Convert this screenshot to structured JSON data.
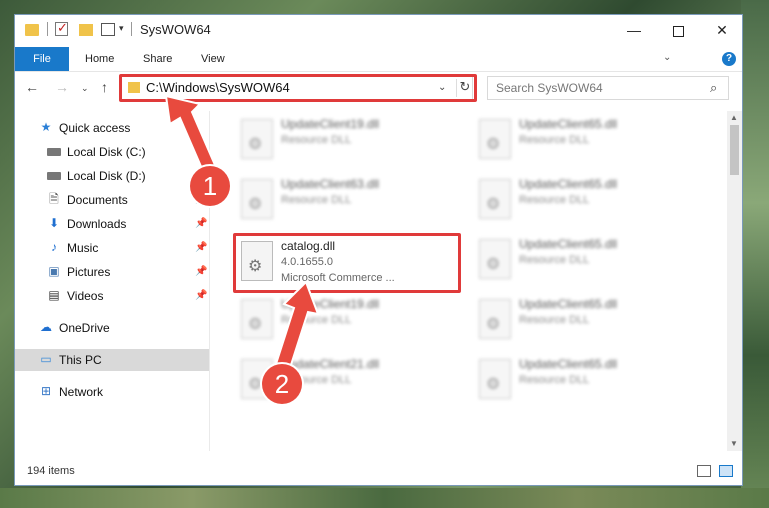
{
  "window": {
    "title": "SysWOW64",
    "controls": {
      "minimize": "—",
      "maximize": "",
      "close": "✕"
    }
  },
  "ribbon": {
    "tabs": [
      "File",
      "Home",
      "Share",
      "View"
    ],
    "collapse_glyph": "⌄",
    "help_glyph": "?"
  },
  "navigation": {
    "back": "←",
    "forward": "→",
    "recent": "⌄",
    "up": "↑",
    "address": "C:\\Windows\\SysWOW64",
    "address_dropdown": "⌄",
    "refresh": "↻",
    "search_placeholder": "Search SysWOW64",
    "search_glyph": "⌕"
  },
  "sidebar": {
    "items": [
      {
        "label": "Quick access",
        "icon": "star-icon",
        "glyph": "★"
      },
      {
        "label": "Local Disk (C:)",
        "icon": "disk-icon",
        "glyph": "",
        "pinned": true
      },
      {
        "label": "Local Disk (D:)",
        "icon": "disk-icon",
        "glyph": "",
        "pinned": true
      },
      {
        "label": "Documents",
        "icon": "documents-icon",
        "glyph": "🗎",
        "pinned": true
      },
      {
        "label": "Downloads",
        "icon": "download-icon",
        "glyph": "⬇",
        "pinned": true
      },
      {
        "label": "Music",
        "icon": "music-icon",
        "glyph": "♪",
        "pinned": true
      },
      {
        "label": "Pictures",
        "icon": "pictures-icon",
        "glyph": "▣",
        "pinned": true
      },
      {
        "label": "Videos",
        "icon": "videos-icon",
        "glyph": "▤",
        "pinned": true
      },
      {
        "label": "OneDrive",
        "icon": "cloud-icon",
        "glyph": "☁"
      },
      {
        "label": "This PC",
        "icon": "computer-icon",
        "glyph": "▭",
        "selected": true
      },
      {
        "label": "Network",
        "icon": "network-icon",
        "glyph": "⊞"
      }
    ],
    "pin_glyph": "📌"
  },
  "files": [
    {
      "name": "UpdateClient19.dll",
      "line1": "Resource DLL",
      "line2": ""
    },
    {
      "name": "UpdateClient65.dll",
      "line1": "Resource DLL",
      "line2": ""
    },
    {
      "name": "UpdateClient63.dll",
      "line1": "Resource DLL",
      "line2": ""
    },
    {
      "name": "UpdateClient65.dll",
      "line1": "Resource DLL",
      "line2": ""
    },
    {
      "name": "catalog.dll",
      "line1": "4.0.1655.0",
      "line2": "Microsoft Commerce ..."
    },
    {
      "name": "UpdateClient65.dll",
      "line1": "Resource DLL",
      "line2": ""
    },
    {
      "name": "UpdateClient19.dll",
      "line1": "Resource DLL",
      "line2": ""
    },
    {
      "name": "UpdateClient65.dll",
      "line1": "Resource DLL",
      "line2": ""
    },
    {
      "name": "UpdateClient21.dll",
      "line1": "Resource DLL",
      "line2": ""
    },
    {
      "name": "UpdateClient65.dll",
      "line1": "Resource DLL",
      "line2": ""
    }
  ],
  "file_glyph": "⚙",
  "status": {
    "item_count": "194 items"
  },
  "annotations": {
    "step1": "1",
    "step2": "2",
    "color": "#e84a3e"
  }
}
